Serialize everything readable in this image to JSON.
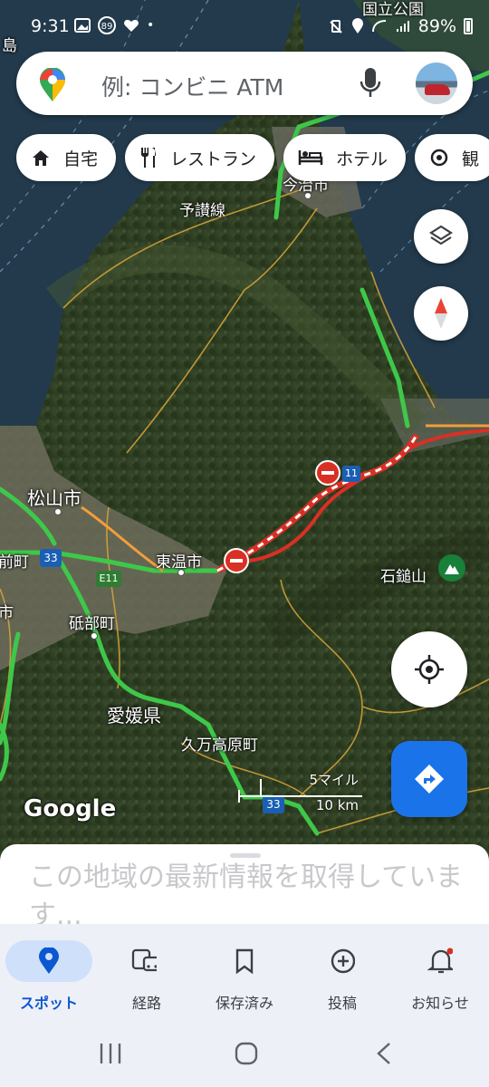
{
  "status_bar": {
    "time": "9:31",
    "notification_count": "89",
    "battery": "89%"
  },
  "search": {
    "placeholder": "例: コンビニ ATM"
  },
  "chips": [
    {
      "label": "自宅",
      "icon": "home-icon"
    },
    {
      "label": "レストラン",
      "icon": "restaurant-icon"
    },
    {
      "label": "ホテル",
      "icon": "hotel-icon"
    },
    {
      "label": "観",
      "icon": "attraction-icon"
    }
  ],
  "map": {
    "labels": {
      "park": "国立公園",
      "island": "島",
      "imabari": "今治市",
      "yosan": "予讃線",
      "matsuyama": "松山市",
      "toon": "東温市",
      "ishizuchi": "石鎚山",
      "tobe": "砥部町",
      "ehime": "愛媛県",
      "kumakogen": "久万高原町",
      "town_left1": "前町",
      "town_left2": "市",
      "route33": "33",
      "route33b": "33",
      "routeE11": "E11",
      "route11": "11"
    },
    "scale": {
      "miles": "5マイル",
      "km": "10 km"
    },
    "attribution": "Google"
  },
  "sheet": {
    "message": "この地域の最新情報を取得しています..."
  },
  "bottom_nav": [
    {
      "label": "スポット",
      "icon": "explore-pin-icon",
      "active": true
    },
    {
      "label": "経路",
      "icon": "commute-icon",
      "active": false
    },
    {
      "label": "保存済み",
      "icon": "bookmark-icon",
      "active": false
    },
    {
      "label": "投稿",
      "icon": "add-circle-icon",
      "active": false
    },
    {
      "label": "お知らせ",
      "icon": "bell-icon",
      "active": false
    }
  ],
  "colors": {
    "accent": "#1a73e8",
    "traffic_green": "#3ec84a",
    "traffic_red": "#d93025",
    "closure_red": "#d93025"
  }
}
